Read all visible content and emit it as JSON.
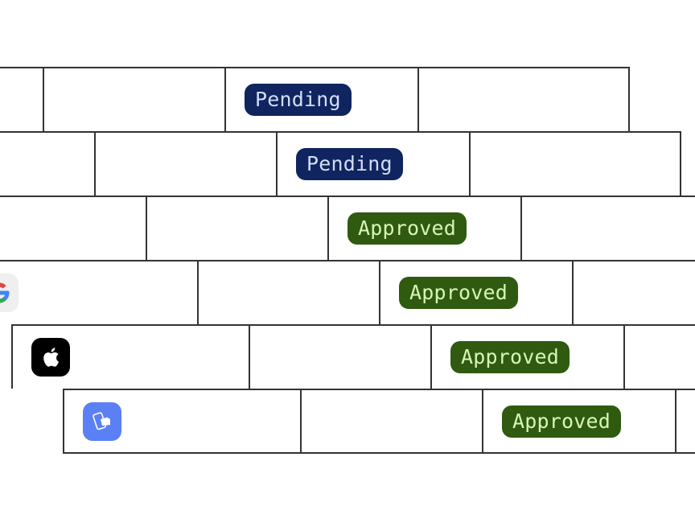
{
  "table": {
    "rows": [
      {
        "app": "",
        "icon": null,
        "col2": "",
        "status": "Pending",
        "status_type": "pending",
        "col4": ""
      },
      {
        "app": "",
        "icon": null,
        "col2": "",
        "status": "Pending",
        "status_type": "pending",
        "col4": ""
      },
      {
        "app": "",
        "icon": null,
        "col2": "",
        "status": "Approved",
        "status_type": "approved",
        "col4": ""
      },
      {
        "app": "",
        "icon": "google-icon",
        "col2": "",
        "status": "Approved",
        "status_type": "approved",
        "col4": ""
      },
      {
        "app": "",
        "icon": "apple-icon",
        "col2": "",
        "status": "Approved",
        "status_type": "approved",
        "col4": ""
      },
      {
        "app": "",
        "icon": "mobile-payment-icon",
        "col2": "",
        "status": "Approved",
        "status_type": "approved",
        "col4": ""
      }
    ]
  },
  "colors": {
    "pending_bg": "#10245f",
    "pending_text": "#d3def7",
    "approved_bg": "#2f5a10",
    "approved_text": "#d8f5b8",
    "border": "#333333"
  }
}
